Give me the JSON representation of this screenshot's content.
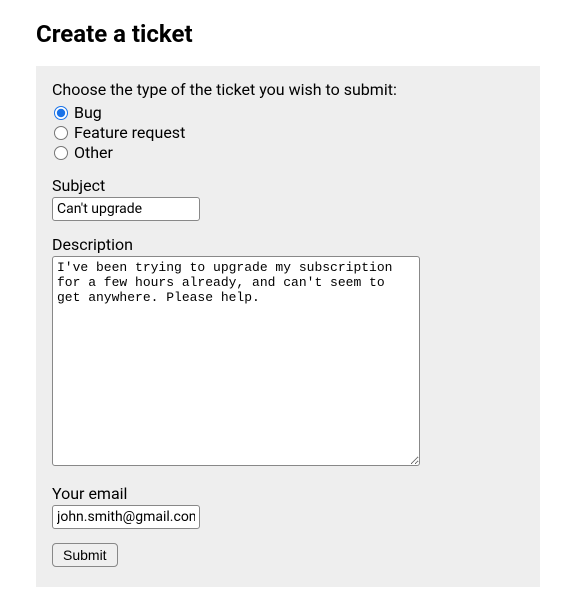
{
  "title": "Create a ticket",
  "form": {
    "type_prompt": "Choose the type of the ticket you wish to submit:",
    "types": {
      "bug": "Bug",
      "feature": "Feature request",
      "other": "Other"
    },
    "selected_type": "bug",
    "subject_label": "Subject",
    "subject_value": "Can't upgrade",
    "description_label": "Description",
    "description_value": "I've been trying to upgrade my subscription for a few hours already, and can't seem to get anywhere. Please help.",
    "email_label": "Your email",
    "email_value": "john.smith@gmail.com",
    "submit_label": "Submit"
  }
}
